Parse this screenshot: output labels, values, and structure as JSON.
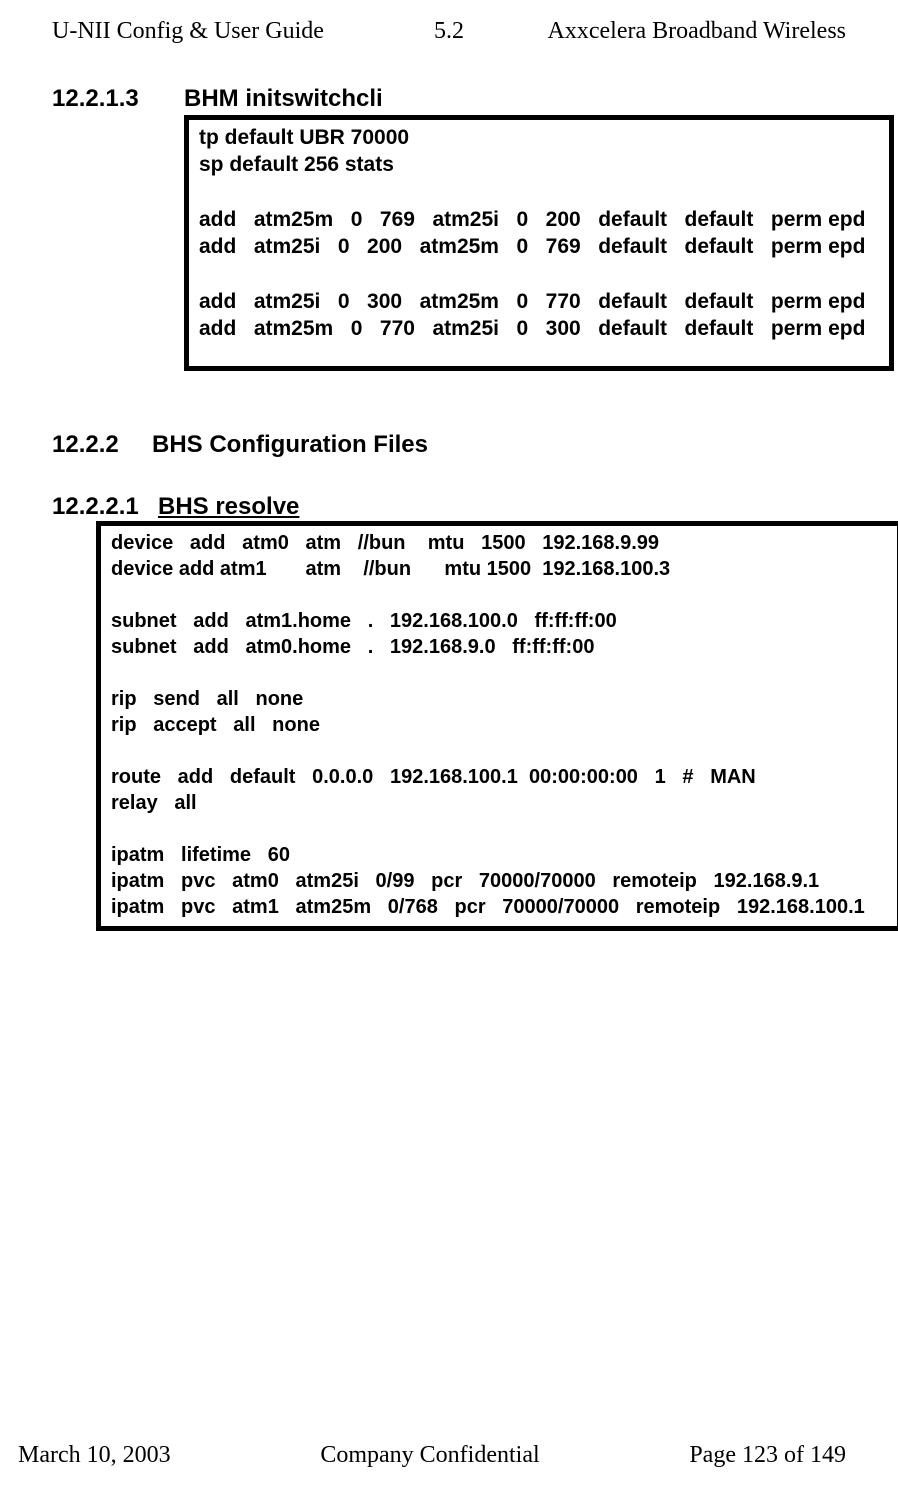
{
  "header": {
    "left": "U-NII Config & User Guide",
    "center": "5.2",
    "right": "Axxcelera Broadband Wireless"
  },
  "s12213": {
    "num": "12.2.1.3",
    "title": "BHM initswitchcli",
    "code": "tp default UBR 70000\nsp default 256 stats\n\nadd   atm25m   0   769   atm25i   0   200   default   default   perm epd\nadd   atm25i   0   200   atm25m   0   769   default   default   perm epd\n\nadd   atm25i   0   300   atm25m   0   770   default   default   perm epd\nadd   atm25m   0   770   atm25i   0   300   default   default   perm epd"
  },
  "s1222": {
    "num": "12.2.2",
    "title": "BHS Configuration Files"
  },
  "s12221": {
    "num": "12.2.2.1",
    "title": "BHS resolve",
    "code": "device   add   atm0   atm   //bun    mtu   1500   192.168.9.99\ndevice add atm1       atm    //bun      mtu 1500  192.168.100.3\n\nsubnet   add   atm1.home   .   192.168.100.0   ff:ff:ff:00\nsubnet   add   atm0.home   .   192.168.9.0   ff:ff:ff:00\n\nrip   send   all   none\nrip   accept   all   none\n\nroute   add   default   0.0.0.0   192.168.100.1  00:00:00:00   1   #   MAN\nrelay   all\n\nipatm   lifetime   60\nipatm   pvc   atm0   atm25i   0/99   pcr   70000/70000   remoteip   192.168.9.1\nipatm   pvc   atm1   atm25m   0/768   pcr   70000/70000   remoteip   192.168.100.1"
  },
  "footer": {
    "left": "March 10, 2003",
    "center": "Company Confidential",
    "right": "Page 123 of 149"
  }
}
